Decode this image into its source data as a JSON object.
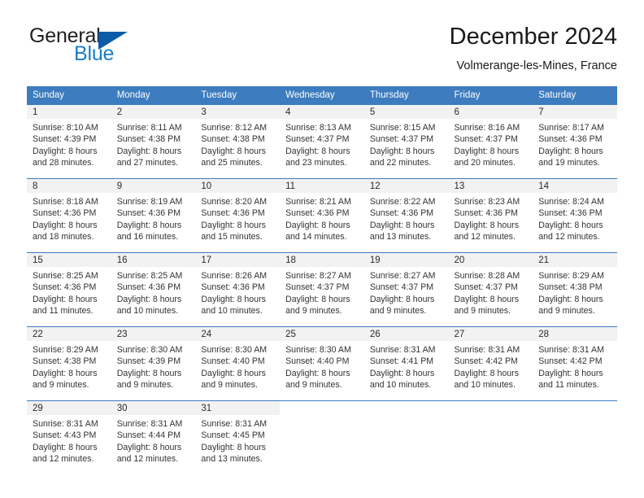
{
  "brand": {
    "word_one": "General",
    "word_two": "Blue",
    "flag_icon": "triangle-flag-icon"
  },
  "header": {
    "title": "December 2024",
    "location": "Volmerange-les-Mines, France"
  },
  "colors": {
    "header_blue": "#3c7cbf",
    "brand_blue": "#1a7dc4",
    "flag_blue": "#0b5ca8",
    "daynum_band": "#f2f2f2"
  },
  "weekday_headers": [
    "Sunday",
    "Monday",
    "Tuesday",
    "Wednesday",
    "Thursday",
    "Friday",
    "Saturday"
  ],
  "labels": {
    "sunrise_prefix": "Sunrise:",
    "sunset_prefix": "Sunset:",
    "daylight_prefix": "Daylight:"
  },
  "weeks": [
    [
      {
        "day": "1",
        "sunrise": "Sunrise: 8:10 AM",
        "sunset": "Sunset: 4:39 PM",
        "daylight_line1": "Daylight: 8 hours",
        "daylight_line2": "and 28 minutes."
      },
      {
        "day": "2",
        "sunrise": "Sunrise: 8:11 AM",
        "sunset": "Sunset: 4:38 PM",
        "daylight_line1": "Daylight: 8 hours",
        "daylight_line2": "and 27 minutes."
      },
      {
        "day": "3",
        "sunrise": "Sunrise: 8:12 AM",
        "sunset": "Sunset: 4:38 PM",
        "daylight_line1": "Daylight: 8 hours",
        "daylight_line2": "and 25 minutes."
      },
      {
        "day": "4",
        "sunrise": "Sunrise: 8:13 AM",
        "sunset": "Sunset: 4:37 PM",
        "daylight_line1": "Daylight: 8 hours",
        "daylight_line2": "and 23 minutes."
      },
      {
        "day": "5",
        "sunrise": "Sunrise: 8:15 AM",
        "sunset": "Sunset: 4:37 PM",
        "daylight_line1": "Daylight: 8 hours",
        "daylight_line2": "and 22 minutes."
      },
      {
        "day": "6",
        "sunrise": "Sunrise: 8:16 AM",
        "sunset": "Sunset: 4:37 PM",
        "daylight_line1": "Daylight: 8 hours",
        "daylight_line2": "and 20 minutes."
      },
      {
        "day": "7",
        "sunrise": "Sunrise: 8:17 AM",
        "sunset": "Sunset: 4:36 PM",
        "daylight_line1": "Daylight: 8 hours",
        "daylight_line2": "and 19 minutes."
      }
    ],
    [
      {
        "day": "8",
        "sunrise": "Sunrise: 8:18 AM",
        "sunset": "Sunset: 4:36 PM",
        "daylight_line1": "Daylight: 8 hours",
        "daylight_line2": "and 18 minutes."
      },
      {
        "day": "9",
        "sunrise": "Sunrise: 8:19 AM",
        "sunset": "Sunset: 4:36 PM",
        "daylight_line1": "Daylight: 8 hours",
        "daylight_line2": "and 16 minutes."
      },
      {
        "day": "10",
        "sunrise": "Sunrise: 8:20 AM",
        "sunset": "Sunset: 4:36 PM",
        "daylight_line1": "Daylight: 8 hours",
        "daylight_line2": "and 15 minutes."
      },
      {
        "day": "11",
        "sunrise": "Sunrise: 8:21 AM",
        "sunset": "Sunset: 4:36 PM",
        "daylight_line1": "Daylight: 8 hours",
        "daylight_line2": "and 14 minutes."
      },
      {
        "day": "12",
        "sunrise": "Sunrise: 8:22 AM",
        "sunset": "Sunset: 4:36 PM",
        "daylight_line1": "Daylight: 8 hours",
        "daylight_line2": "and 13 minutes."
      },
      {
        "day": "13",
        "sunrise": "Sunrise: 8:23 AM",
        "sunset": "Sunset: 4:36 PM",
        "daylight_line1": "Daylight: 8 hours",
        "daylight_line2": "and 12 minutes."
      },
      {
        "day": "14",
        "sunrise": "Sunrise: 8:24 AM",
        "sunset": "Sunset: 4:36 PM",
        "daylight_line1": "Daylight: 8 hours",
        "daylight_line2": "and 12 minutes."
      }
    ],
    [
      {
        "day": "15",
        "sunrise": "Sunrise: 8:25 AM",
        "sunset": "Sunset: 4:36 PM",
        "daylight_line1": "Daylight: 8 hours",
        "daylight_line2": "and 11 minutes."
      },
      {
        "day": "16",
        "sunrise": "Sunrise: 8:25 AM",
        "sunset": "Sunset: 4:36 PM",
        "daylight_line1": "Daylight: 8 hours",
        "daylight_line2": "and 10 minutes."
      },
      {
        "day": "17",
        "sunrise": "Sunrise: 8:26 AM",
        "sunset": "Sunset: 4:36 PM",
        "daylight_line1": "Daylight: 8 hours",
        "daylight_line2": "and 10 minutes."
      },
      {
        "day": "18",
        "sunrise": "Sunrise: 8:27 AM",
        "sunset": "Sunset: 4:37 PM",
        "daylight_line1": "Daylight: 8 hours",
        "daylight_line2": "and 9 minutes."
      },
      {
        "day": "19",
        "sunrise": "Sunrise: 8:27 AM",
        "sunset": "Sunset: 4:37 PM",
        "daylight_line1": "Daylight: 8 hours",
        "daylight_line2": "and 9 minutes."
      },
      {
        "day": "20",
        "sunrise": "Sunrise: 8:28 AM",
        "sunset": "Sunset: 4:37 PM",
        "daylight_line1": "Daylight: 8 hours",
        "daylight_line2": "and 9 minutes."
      },
      {
        "day": "21",
        "sunrise": "Sunrise: 8:29 AM",
        "sunset": "Sunset: 4:38 PM",
        "daylight_line1": "Daylight: 8 hours",
        "daylight_line2": "and 9 minutes."
      }
    ],
    [
      {
        "day": "22",
        "sunrise": "Sunrise: 8:29 AM",
        "sunset": "Sunset: 4:38 PM",
        "daylight_line1": "Daylight: 8 hours",
        "daylight_line2": "and 9 minutes."
      },
      {
        "day": "23",
        "sunrise": "Sunrise: 8:30 AM",
        "sunset": "Sunset: 4:39 PM",
        "daylight_line1": "Daylight: 8 hours",
        "daylight_line2": "and 9 minutes."
      },
      {
        "day": "24",
        "sunrise": "Sunrise: 8:30 AM",
        "sunset": "Sunset: 4:40 PM",
        "daylight_line1": "Daylight: 8 hours",
        "daylight_line2": "and 9 minutes."
      },
      {
        "day": "25",
        "sunrise": "Sunrise: 8:30 AM",
        "sunset": "Sunset: 4:40 PM",
        "daylight_line1": "Daylight: 8 hours",
        "daylight_line2": "and 9 minutes."
      },
      {
        "day": "26",
        "sunrise": "Sunrise: 8:31 AM",
        "sunset": "Sunset: 4:41 PM",
        "daylight_line1": "Daylight: 8 hours",
        "daylight_line2": "and 10 minutes."
      },
      {
        "day": "27",
        "sunrise": "Sunrise: 8:31 AM",
        "sunset": "Sunset: 4:42 PM",
        "daylight_line1": "Daylight: 8 hours",
        "daylight_line2": "and 10 minutes."
      },
      {
        "day": "28",
        "sunrise": "Sunrise: 8:31 AM",
        "sunset": "Sunset: 4:42 PM",
        "daylight_line1": "Daylight: 8 hours",
        "daylight_line2": "and 11 minutes."
      }
    ],
    [
      {
        "day": "29",
        "sunrise": "Sunrise: 8:31 AM",
        "sunset": "Sunset: 4:43 PM",
        "daylight_line1": "Daylight: 8 hours",
        "daylight_line2": "and 12 minutes."
      },
      {
        "day": "30",
        "sunrise": "Sunrise: 8:31 AM",
        "sunset": "Sunset: 4:44 PM",
        "daylight_line1": "Daylight: 8 hours",
        "daylight_line2": "and 12 minutes."
      },
      {
        "day": "31",
        "sunrise": "Sunrise: 8:31 AM",
        "sunset": "Sunset: 4:45 PM",
        "daylight_line1": "Daylight: 8 hours",
        "daylight_line2": "and 13 minutes."
      },
      {
        "day": "",
        "sunrise": "",
        "sunset": "",
        "daylight_line1": "",
        "daylight_line2": ""
      },
      {
        "day": "",
        "sunrise": "",
        "sunset": "",
        "daylight_line1": "",
        "daylight_line2": ""
      },
      {
        "day": "",
        "sunrise": "",
        "sunset": "",
        "daylight_line1": "",
        "daylight_line2": ""
      },
      {
        "day": "",
        "sunrise": "",
        "sunset": "",
        "daylight_line1": "",
        "daylight_line2": ""
      }
    ]
  ]
}
